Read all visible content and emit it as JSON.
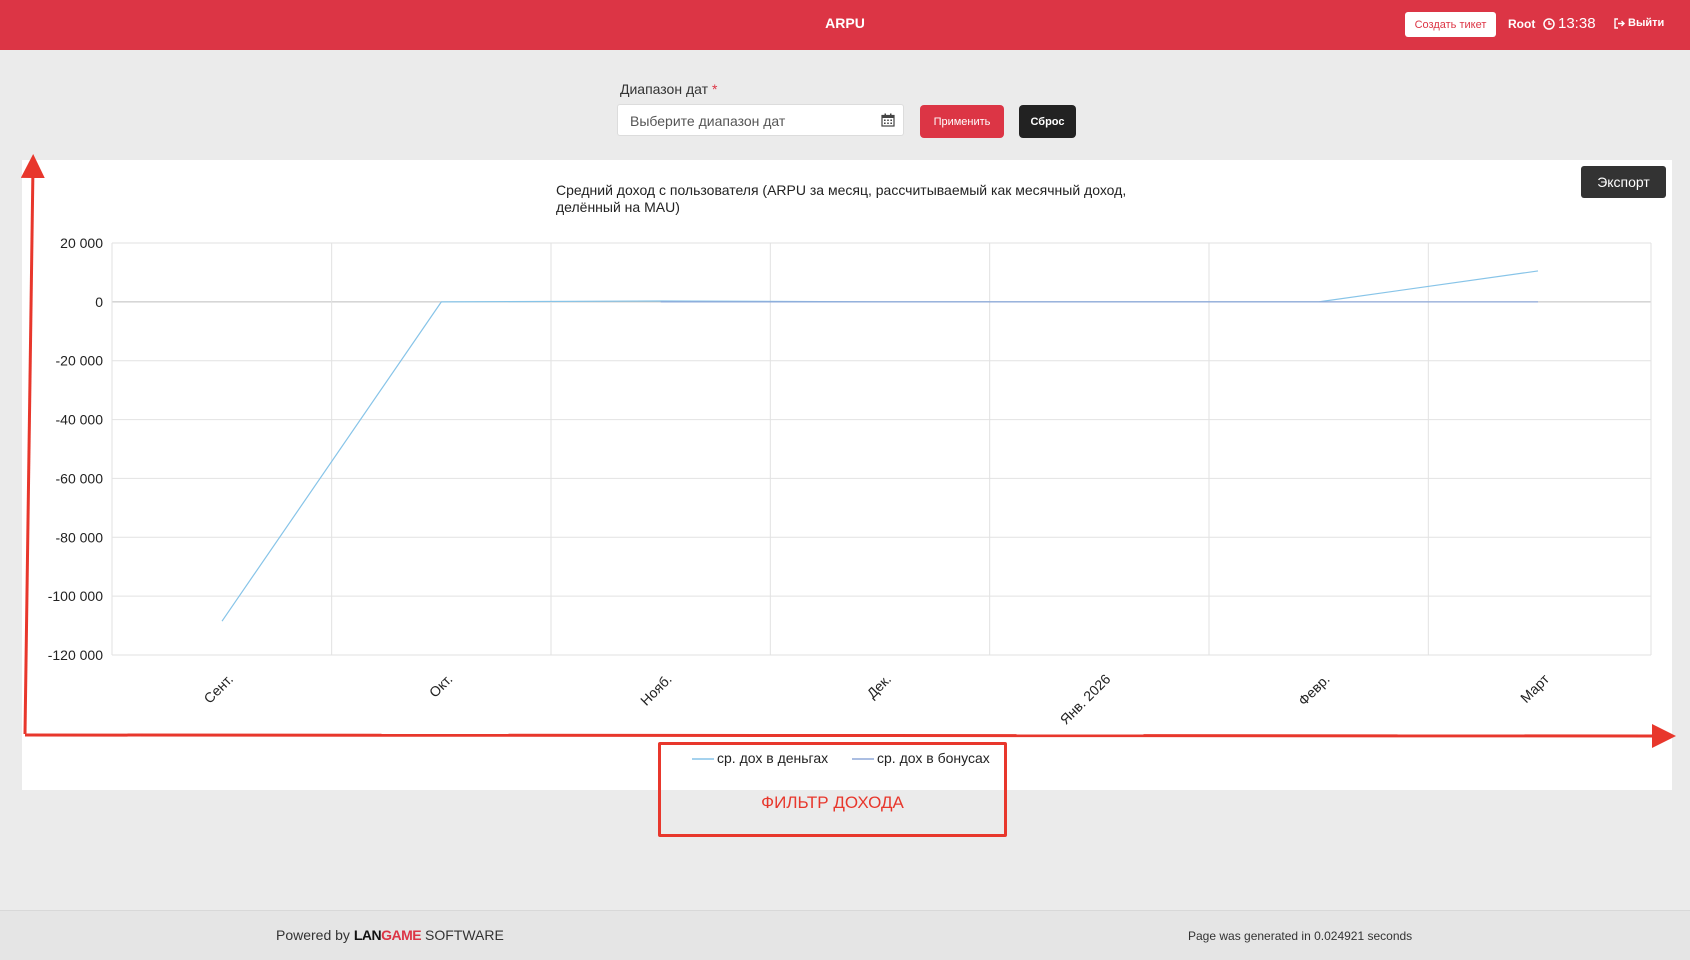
{
  "header": {
    "title": "ARPU",
    "ticket_label": "Создать тикет",
    "user": "Root",
    "time": "13:38",
    "logout_label": "Выйти"
  },
  "filter": {
    "label": "Диапазон дат",
    "required_mark": "*",
    "placeholder": "Выберите диапазон дат",
    "apply_label": "Применить",
    "reset_label": "Сброс"
  },
  "export_label": "Экспорт",
  "chart_data": {
    "type": "line",
    "title_lines": [
      "Средний доход с пользователя (ARPU за месяц, рассчитываемый как месячный доход,",
      "делённый на MAU)"
    ],
    "categories": [
      "Сент.",
      "Окт.",
      "Нояб.",
      "Дек.",
      "Янв. 2026",
      "Февр.",
      "Март"
    ],
    "yticks": [
      "20 000",
      "0",
      "-20 000",
      "-40 000",
      "-60 000",
      "-80 000",
      "-100 000",
      "-120 000"
    ],
    "ylim": [
      -120000,
      20000
    ],
    "grid": true,
    "legend_position": "bottom",
    "series": [
      {
        "name": "ср. дох в деньгах",
        "color": "#87c4e8",
        "values": [
          -108500,
          0,
          300,
          0,
          0,
          0,
          10500
        ]
      },
      {
        "name": "ср. дох в бонусах",
        "color": "#8fa8d8",
        "values": [
          null,
          null,
          0,
          0,
          0,
          0,
          0
        ]
      }
    ]
  },
  "annotation": {
    "text": "ФИЛЬТР ДОХОДА",
    "color": "#e8372c"
  },
  "footer": {
    "powered_prefix": "Powered by",
    "logo_part1": "LAN",
    "logo_part2": "GAME",
    "logo_suffix": "SOFTWARE",
    "generated": "Page was generated in 0.024921 seconds"
  }
}
